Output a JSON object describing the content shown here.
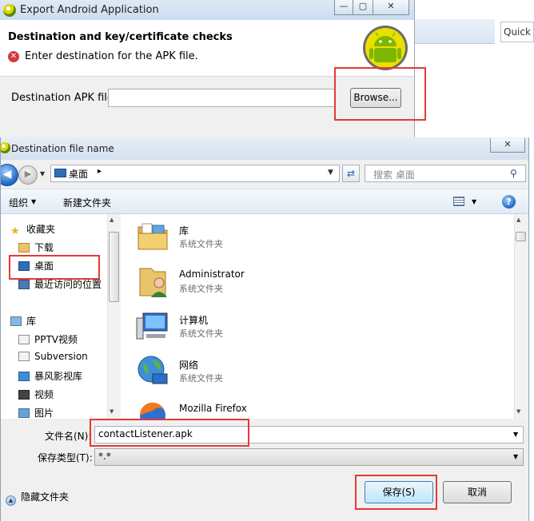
{
  "export_window": {
    "title": "Export Android Application",
    "heading": "Destination and key/certificate checks",
    "error_message": "Enter destination for the APK file.",
    "destination_label": "Destination APK file:",
    "destination_value": "",
    "browse_label": "Browse..."
  },
  "background": {
    "quick_access": "Quick"
  },
  "dialog": {
    "title": "Destination file name",
    "address": "桌面",
    "search_placeholder": "搜索 桌面",
    "toolbar": {
      "organize": "组织",
      "new_folder": "新建文件夹"
    },
    "nav": {
      "favorites": "收藏夹",
      "items": [
        "下载",
        "桌面",
        "最近访问的位置"
      ],
      "libraries": "库",
      "library_items": [
        "PPTV视频",
        "Subversion",
        "暴风影视库",
        "视频",
        "图片"
      ]
    },
    "files": [
      {
        "name": "库",
        "type": "系统文件夹",
        "icon": "library-icon"
      },
      {
        "name": "Administrator",
        "type": "系统文件夹",
        "icon": "user-folder-icon"
      },
      {
        "name": "计算机",
        "type": "系统文件夹",
        "icon": "computer-icon"
      },
      {
        "name": "网络",
        "type": "系统文件夹",
        "icon": "network-icon"
      },
      {
        "name": "Mozilla Firefox",
        "type": "",
        "icon": "firefox-icon"
      }
    ],
    "filename_label": "文件名(N):",
    "filename_value": "contactListener.apk",
    "filetype_label": "保存类型(T):",
    "filetype_value": "*.*",
    "hide_folders": "隐藏文件夹",
    "save_label": "保存(S)",
    "cancel_label": "取消"
  },
  "colors": {
    "highlight": "#e53935",
    "titlebar": "#d3e0ef",
    "error": "#d23a3a"
  }
}
